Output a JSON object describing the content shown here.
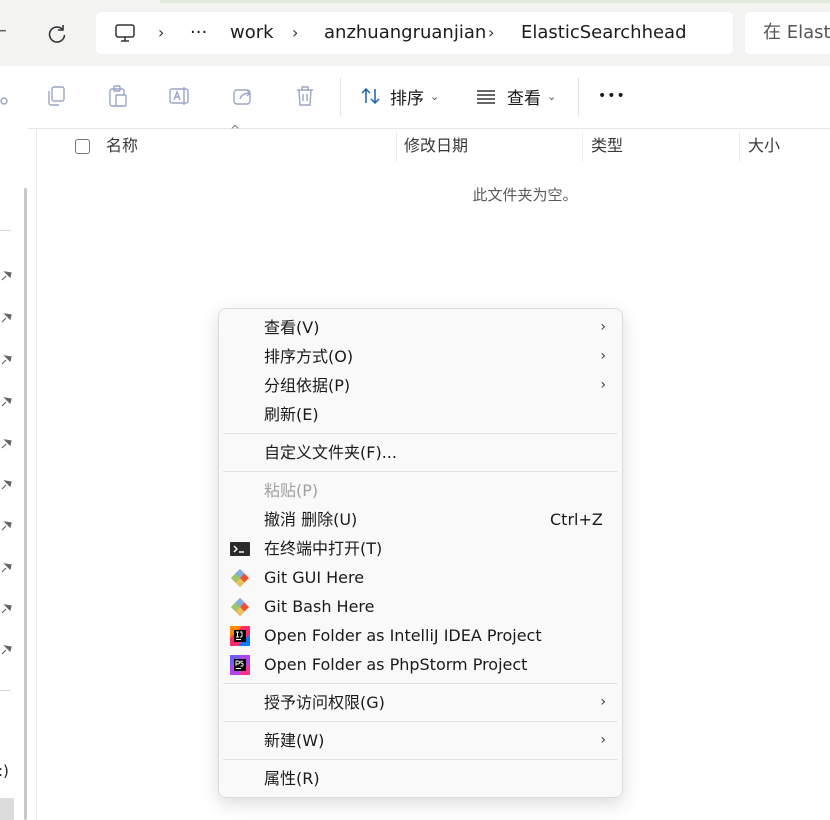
{
  "address_bar": {
    "overflow": "···",
    "crumbs": [
      "work",
      "anzhuangruanjian",
      "ElasticSearchhead"
    ],
    "search_placeholder": "在 Elasti"
  },
  "toolbar": {
    "sort_label": "排序",
    "view_label": "查看",
    "more": "•••"
  },
  "columns": {
    "name": "名称",
    "modified": "修改日期",
    "type": "类型",
    "size": "大小"
  },
  "empty_message": "此文件夹为空。",
  "nav": {
    "drive_fragment": ":)"
  },
  "context_menu": {
    "view": "查看(V)",
    "sort_by": "排序方式(O)",
    "group_by": "分组依据(P)",
    "refresh": "刷新(E)",
    "customize": "自定义文件夹(F)...",
    "paste": "粘贴(P)",
    "undo_delete": "撤消 删除(U)",
    "undo_shortcut": "Ctrl+Z",
    "open_terminal": "在终端中打开(T)",
    "git_gui": "Git GUI Here",
    "git_bash": "Git Bash Here",
    "intellij": "Open Folder as IntelliJ IDEA Project",
    "phpstorm": "Open Folder as PhpStorm Project",
    "give_access": "授予访问权限(G)",
    "new": "新建(W)",
    "properties": "属性(R)"
  },
  "icons": [
    "refresh-icon",
    "this-pc-icon",
    "copy-icon",
    "paste-icon",
    "rename-icon",
    "share-icon",
    "delete-icon",
    "sort-icon",
    "view-icon",
    "pin-icon",
    "terminal-icon",
    "git-icon",
    "intellij-icon",
    "phpstorm-icon"
  ],
  "colors": {
    "accent_green": "#dfe9dc",
    "menu_bg": "#f9f9f9",
    "git": "#f05032",
    "intellij": "#fc2b6a",
    "phpstorm": "#b345f1"
  }
}
